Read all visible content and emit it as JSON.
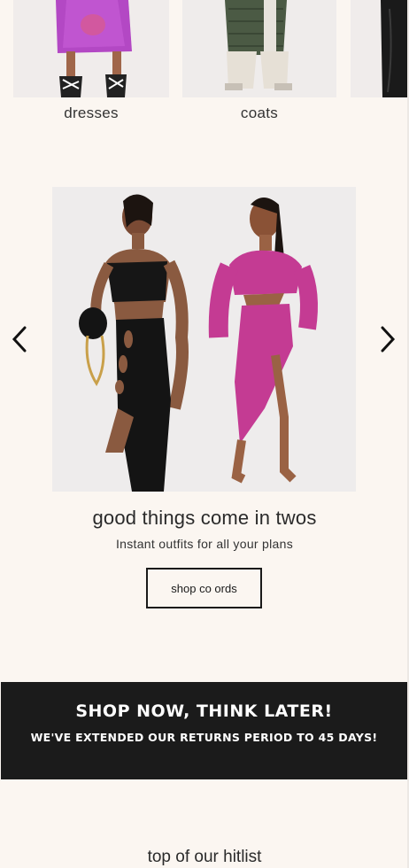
{
  "categories": [
    {
      "label": "dresses"
    },
    {
      "label": "coats"
    }
  ],
  "carousel": {
    "prev_icon": "chevron-left-icon",
    "next_icon": "chevron-right-icon",
    "title": "good things come in twos",
    "subtitle": "Instant outfits for all your plans",
    "cta_label": "shop co ords"
  },
  "banner": {
    "title": "SHOP NOW, THINK LATER!",
    "subtitle": "WE'VE EXTENDED OUR RETURNS PERIOD TO 45 DAYS!"
  },
  "section": {
    "title": "top of our hitlist"
  },
  "colors": {
    "background": "#fbf6f1",
    "banner": "#1b1b1b",
    "pink": "#c43b93",
    "purple": "#b348c4"
  }
}
